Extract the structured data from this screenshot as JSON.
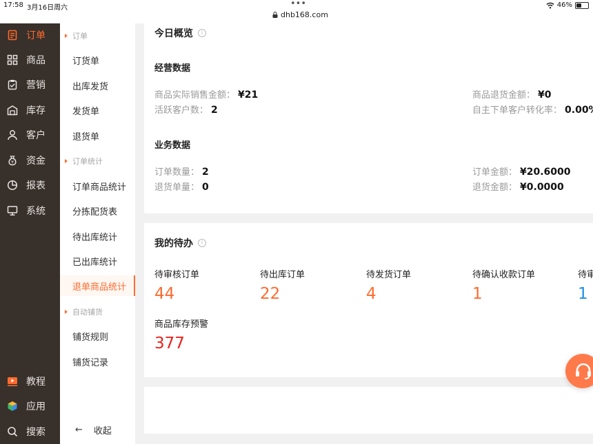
{
  "status": {
    "time": "17:58",
    "date": "3月16日周六",
    "url": "dhb168.com",
    "battery": "46%",
    "battery_level": 0.46
  },
  "sidebar": {
    "items": [
      {
        "label": "订单",
        "icon": "order-icon"
      },
      {
        "label": "商品",
        "icon": "goods-icon"
      },
      {
        "label": "营销",
        "icon": "marketing-icon"
      },
      {
        "label": "库存",
        "icon": "warehouse-icon"
      },
      {
        "label": "客户",
        "icon": "customer-icon"
      },
      {
        "label": "资金",
        "icon": "money-bag-icon"
      },
      {
        "label": "报表",
        "icon": "pie-chart-icon"
      },
      {
        "label": "系统",
        "icon": "monitor-icon"
      }
    ],
    "bottom": [
      {
        "label": "教程",
        "icon": "video-icon"
      },
      {
        "label": "应用",
        "icon": "cube-icon"
      },
      {
        "label": "搜索",
        "icon": "search-icon"
      }
    ]
  },
  "submenu": {
    "sections": [
      {
        "title": "订单",
        "items": [
          "订货单",
          "出库发货",
          "发货单",
          "退货单"
        ]
      },
      {
        "title": "订单统计",
        "items": [
          "订单商品统计",
          "分拣配货表",
          "待出库统计",
          "已出库统计",
          "退单商品统计"
        ]
      },
      {
        "title": "自动铺货",
        "items": [
          "铺货规则",
          "铺货记录"
        ]
      }
    ],
    "active": "退单商品统计",
    "collapse_label": "收起"
  },
  "overview": {
    "title": "今日概览",
    "operating": {
      "title": "经营数据",
      "sales_label": "商品实际销售金额：",
      "sales_value": "¥21",
      "active_label": "活跃客户数：",
      "active_value": "2",
      "refund_label": "商品退货金额：",
      "refund_value": "¥0",
      "conversion_label": "自主下单客户转化率：",
      "conversion_value": "0.00%"
    },
    "business": {
      "title": "业务数据",
      "order_count_label": "订单数量：",
      "order_count_value": "2",
      "return_count_label": "退货单量：",
      "return_count_value": "0",
      "order_amount_label": "订单金额：",
      "order_amount_value": "¥20.6000",
      "return_amount_label": "退货金额：",
      "return_amount_value": "¥0.0000"
    }
  },
  "todo": {
    "title": "我的待办",
    "items": [
      {
        "label": "待审核订单",
        "value": "44"
      },
      {
        "label": "待出库订单",
        "value": "22"
      },
      {
        "label": "待发货订单",
        "value": "4"
      },
      {
        "label": "待确认收款订单",
        "value": "1"
      },
      {
        "label": "待审",
        "value": "1"
      }
    ],
    "stock_alert": {
      "label": "商品库存预警",
      "value": "377"
    }
  },
  "colors": {
    "accent": "#ff6b2e",
    "sidebar_bg": "#38302b",
    "blue": "#1e90e6",
    "red": "#e6231e"
  }
}
